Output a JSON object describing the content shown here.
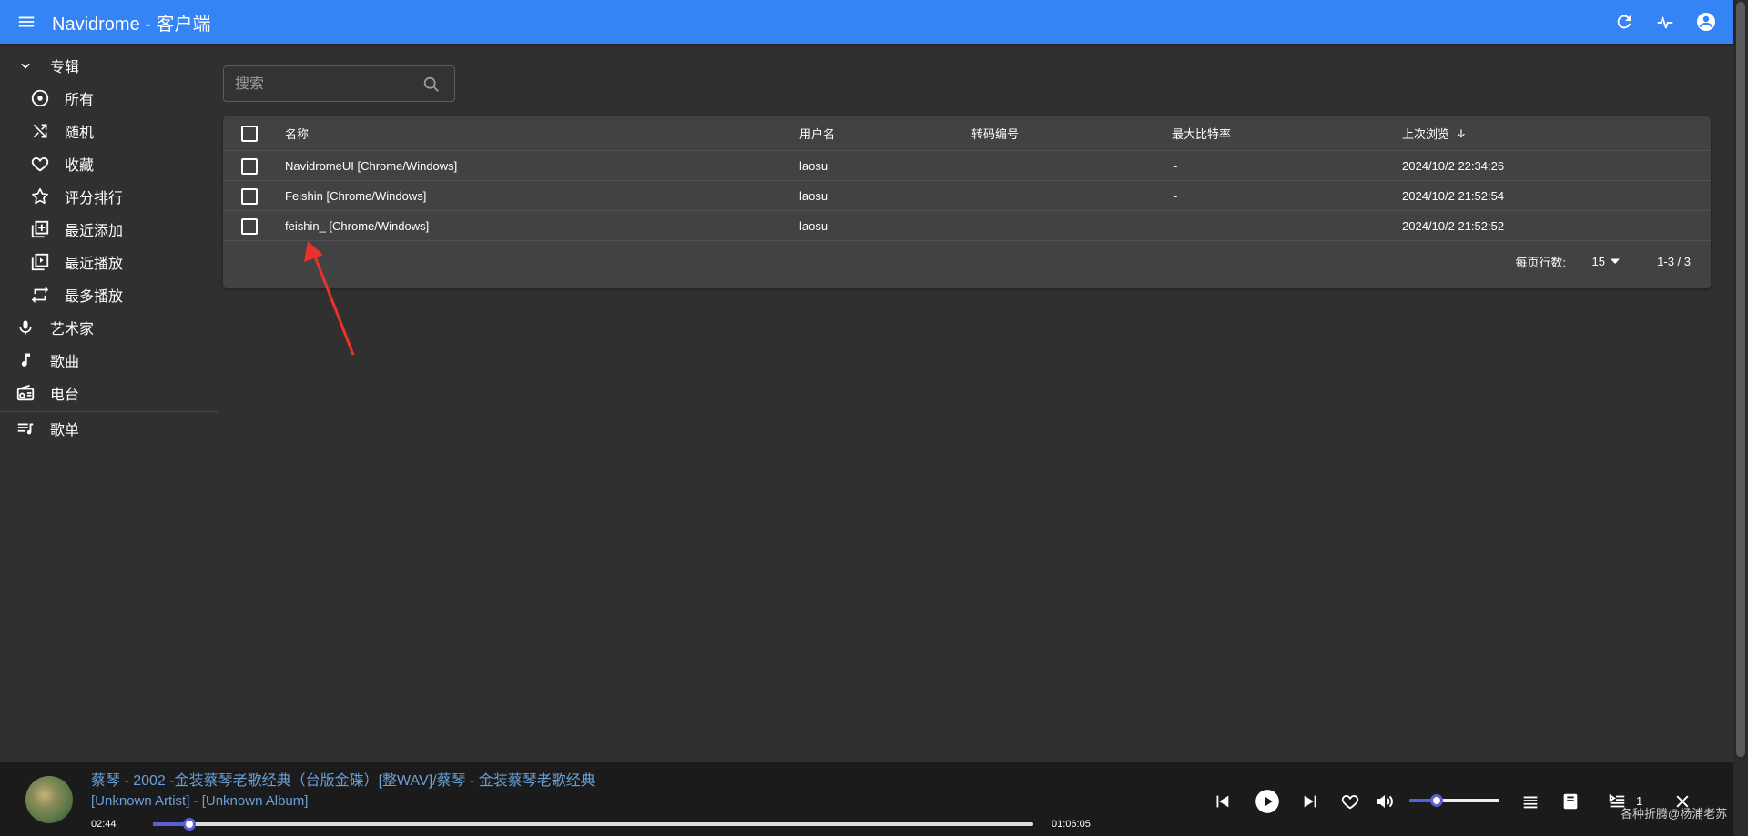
{
  "app": {
    "title": "Navidrome - 客户端"
  },
  "header": {
    "icons": [
      "menu-icon",
      "refresh-icon",
      "activity-icon",
      "account-icon"
    ]
  },
  "sidebar": {
    "albums_group": "专辑",
    "album_items": [
      {
        "label": "所有",
        "icon": "album-icon"
      },
      {
        "label": "随机",
        "icon": "shuffle-icon"
      },
      {
        "label": "收藏",
        "icon": "heart-icon"
      },
      {
        "label": "评分排行",
        "icon": "star-icon"
      },
      {
        "label": "最近添加",
        "icon": "library-add-icon"
      },
      {
        "label": "最近播放",
        "icon": "video-library-icon"
      },
      {
        "label": "最多播放",
        "icon": "repeat-icon"
      }
    ],
    "artists": "艺术家",
    "songs": "歌曲",
    "radio": "电台",
    "playlists": "歌单"
  },
  "search": {
    "placeholder": "搜索"
  },
  "table": {
    "columns": {
      "name": "名称",
      "username": "用户名",
      "transcoding": "转码编号",
      "max_bitrate": "最大比特率",
      "last_seen": "上次浏览"
    },
    "rows": [
      {
        "name": "NavidromeUI [Chrome/Windows]",
        "username": "laosu",
        "transcoding": "",
        "max_bitrate": "-",
        "last_seen": "2024/10/2 22:34:26"
      },
      {
        "name": "Feishin [Chrome/Windows]",
        "username": "laosu",
        "transcoding": "",
        "max_bitrate": "-",
        "last_seen": "2024/10/2 21:52:54"
      },
      {
        "name": "feishin_ [Chrome/Windows]",
        "username": "laosu",
        "transcoding": "",
        "max_bitrate": "-",
        "last_seen": "2024/10/2 21:52:52"
      }
    ],
    "rows_per_page_label": "每页行数:",
    "rows_per_page": "15",
    "range": "1-3 / 3"
  },
  "player": {
    "title": "蔡琴 - 2002 -金装蔡琴老歌经典（台版金碟）[整WAV]/蔡琴 - 金装蔡琴老歌经典",
    "subtitle": "[Unknown Artist] - [Unknown Album]",
    "current_time": "02:44",
    "total_time": "01:06:05",
    "progress": 0.041,
    "volume": 0.3,
    "queue_count": "1"
  },
  "watermark": "各种折腾@杨浦老苏",
  "colors": {
    "appbar": "#3584f5",
    "background": "#303030",
    "card": "#424242",
    "accent": "#5b5fd6",
    "link": "#6aa0d6",
    "annotation_arrow": "#e8322b"
  }
}
